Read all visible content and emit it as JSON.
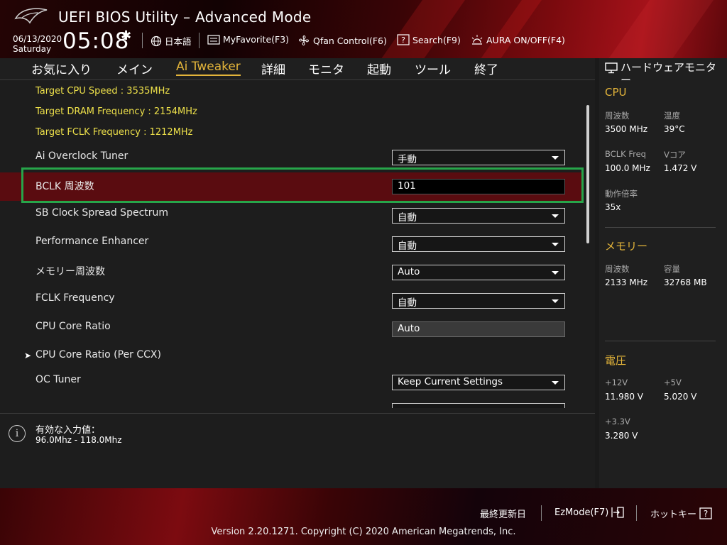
{
  "header": {
    "title": "UEFI BIOS Utility – Advanced Mode",
    "date": "06/13/2020",
    "day": "Saturday",
    "time": "05:08",
    "language": "日本語",
    "myfavorite": "MyFavorite(F3)",
    "qfan": "Qfan Control(F6)",
    "search": "Search(F9)",
    "aura": "AURA ON/OFF(F4)"
  },
  "tabs": [
    {
      "label": "お気に入り",
      "active": false
    },
    {
      "label": "メイン",
      "active": false
    },
    {
      "label": "Ai Tweaker",
      "active": true
    },
    {
      "label": "詳細",
      "active": false
    },
    {
      "label": "モニタ",
      "active": false
    },
    {
      "label": "起動",
      "active": false
    },
    {
      "label": "ツール",
      "active": false
    },
    {
      "label": "終了",
      "active": false
    }
  ],
  "info_lines": [
    "Target CPU Speed : 3535MHz",
    "Target DRAM Frequency : 2154MHz",
    "Target FCLK Frequency : 1212MHz"
  ],
  "settings": [
    {
      "label": "Ai Overclock Tuner",
      "value": "手動"
    },
    {
      "label": "BCLK 周波数",
      "value": "101"
    },
    {
      "label": "SB Clock Spread Spectrum",
      "value": "自動"
    },
    {
      "label": "Performance Enhancer",
      "value": "自動"
    },
    {
      "label": "メモリー周波数",
      "value": "Auto"
    },
    {
      "label": "FCLK Frequency",
      "value": "自動"
    },
    {
      "label": "CPU Core Ratio",
      "value": "Auto"
    },
    {
      "label": "CPU Core Ratio (Per CCX)",
      "value": ""
    },
    {
      "label": "OC Tuner",
      "value": "Keep Current Settings"
    }
  ],
  "help": {
    "title": "有効な入力値：",
    "value": "96.0Mhz - 118.0Mhz"
  },
  "monitor": {
    "title": "ハードウェアモニター",
    "cpu": {
      "heading": "CPU",
      "freq_label": "周波数",
      "freq_value": "3500 MHz",
      "temp_label": "温度",
      "temp_value": "39°C",
      "bclk_label": "BCLK Freq",
      "bclk_value": "100.0 MHz",
      "vcore_label": "Vコア",
      "vcore_value": "1.472 V",
      "ratio_label": "動作倍率",
      "ratio_value": "35x"
    },
    "memory": {
      "heading": "メモリー",
      "freq_label": "周波数",
      "freq_value": "2133 MHz",
      "cap_label": "容量",
      "cap_value": "32768 MB"
    },
    "voltage": {
      "heading": "電圧",
      "v12_label": "+12V",
      "v12_value": "11.980 V",
      "v5_label": "+5V",
      "v5_value": "5.020 V",
      "v33_label": "+3.3V",
      "v33_value": "3.280 V"
    }
  },
  "footer": {
    "last_modified": "最終更新日",
    "ezmode": "EzMode(F7)",
    "hotkeys": "ホットキー",
    "copyright": "Version 2.20.1271. Copyright (C) 2020 American Megatrends, Inc."
  },
  "colors": {
    "accent": "#e3b43a",
    "info_text": "#ede04a",
    "selected_row": "#5a0c10",
    "highlight_box": "#27a54a"
  }
}
